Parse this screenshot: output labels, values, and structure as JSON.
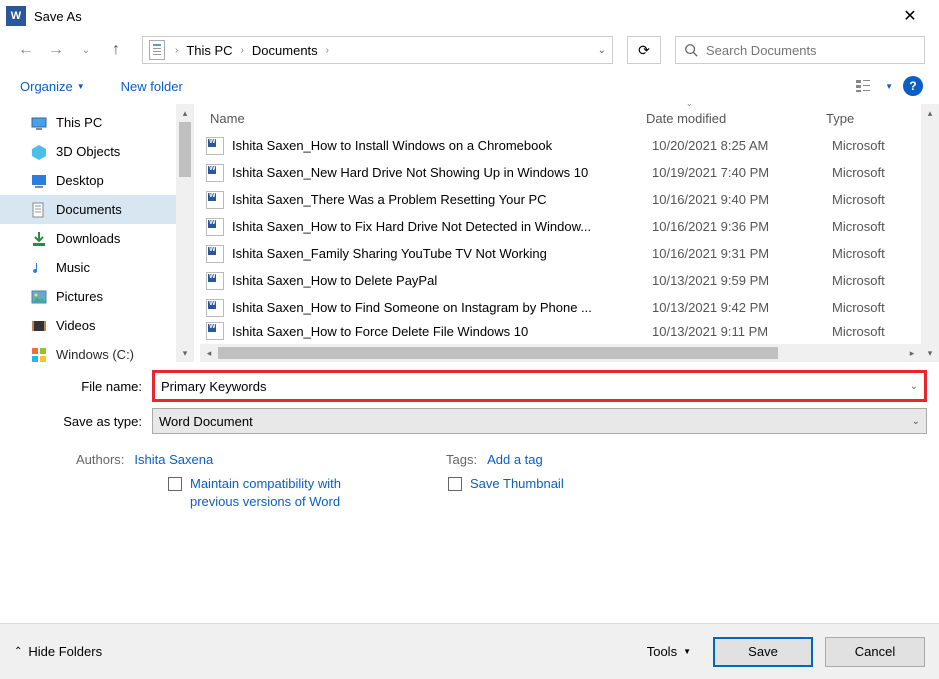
{
  "title": "Save As",
  "breadcrumb": {
    "seg1": "This PC",
    "seg2": "Documents"
  },
  "search": {
    "placeholder": "Search Documents"
  },
  "toolbar": {
    "organize": "Organize",
    "newfolder": "New folder"
  },
  "sidebar": {
    "items": [
      {
        "label": "This PC"
      },
      {
        "label": "3D Objects"
      },
      {
        "label": "Desktop"
      },
      {
        "label": "Documents"
      },
      {
        "label": "Downloads"
      },
      {
        "label": "Music"
      },
      {
        "label": "Pictures"
      },
      {
        "label": "Videos"
      },
      {
        "label": "Windows (C:)"
      }
    ]
  },
  "columns": {
    "name": "Name",
    "date": "Date modified",
    "type": "Type"
  },
  "files": [
    {
      "name": "Ishita Saxen_How to Install Windows on a Chromebook",
      "date": "10/20/2021 8:25 AM",
      "type": "Microsoft"
    },
    {
      "name": "Ishita Saxen_New Hard Drive Not Showing Up in Windows 10",
      "date": "10/19/2021 7:40 PM",
      "type": "Microsoft"
    },
    {
      "name": "Ishita Saxen_There Was a Problem Resetting Your PC",
      "date": "10/16/2021 9:40 PM",
      "type": "Microsoft"
    },
    {
      "name": "Ishita Saxen_How to Fix Hard Drive Not Detected in Window...",
      "date": "10/16/2021 9:36 PM",
      "type": "Microsoft"
    },
    {
      "name": "Ishita Saxen_Family Sharing YouTube TV Not Working",
      "date": "10/16/2021 9:31 PM",
      "type": "Microsoft"
    },
    {
      "name": "Ishita Saxen_How to Delete PayPal",
      "date": "10/13/2021 9:59 PM",
      "type": "Microsoft"
    },
    {
      "name": "Ishita Saxen_How to Find Someone on Instagram by Phone ...",
      "date": "10/13/2021 9:42 PM",
      "type": "Microsoft"
    },
    {
      "name": "Ishita Saxen_How to Force Delete File Windows 10",
      "date": "10/13/2021 9:11 PM",
      "type": "Microsoft"
    }
  ],
  "form": {
    "filename_label": "File name:",
    "filename_value": "Primary Keywords",
    "savetype_label": "Save as type:",
    "savetype_value": "Word Document",
    "authors_label": "Authors:",
    "authors_value": "Ishita Saxena",
    "tags_label": "Tags:",
    "tags_value": "Add a tag",
    "maintain_label": "Maintain compatibility with previous versions of Word",
    "thumb_label": "Save Thumbnail"
  },
  "footer": {
    "hide": "Hide Folders",
    "tools": "Tools",
    "save": "Save",
    "cancel": "Cancel"
  }
}
